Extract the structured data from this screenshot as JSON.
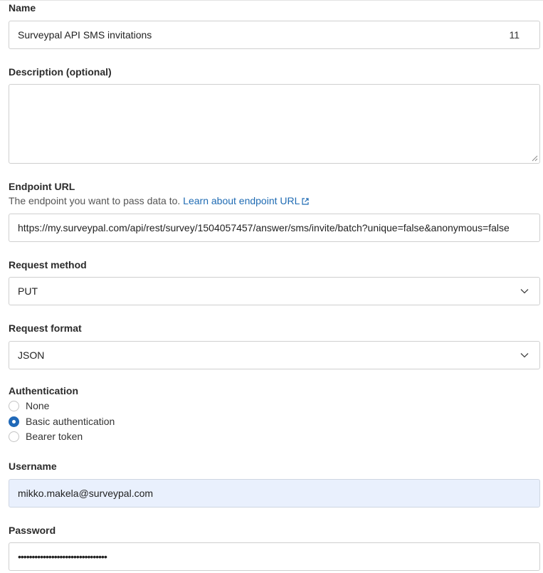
{
  "name": {
    "label": "Name",
    "value": "Surveypal API SMS invitations",
    "counter": "11"
  },
  "description": {
    "label": "Description (optional)",
    "value": ""
  },
  "endpoint": {
    "label": "Endpoint URL",
    "help": "The endpoint you want to pass data to.",
    "help_link": "Learn about endpoint URL",
    "value": "https://my.surveypal.com/api/rest/survey/1504057457/answer/sms/invite/batch?unique=false&anonymous=false"
  },
  "request_method": {
    "label": "Request method",
    "value": "PUT"
  },
  "request_format": {
    "label": "Request format",
    "value": "JSON"
  },
  "authentication": {
    "label": "Authentication",
    "options": [
      "None",
      "Basic authentication",
      "Bearer token"
    ],
    "selected": "Basic authentication"
  },
  "username": {
    "label": "Username",
    "value": "mikko.makela@surveypal.com"
  },
  "password": {
    "label": "Password",
    "masked_value": "••••••••••••••••••••••••••••••••"
  },
  "colors": {
    "accent": "#2069b8",
    "link": "#1f6bb3",
    "autofill": "#e9f0fd"
  }
}
